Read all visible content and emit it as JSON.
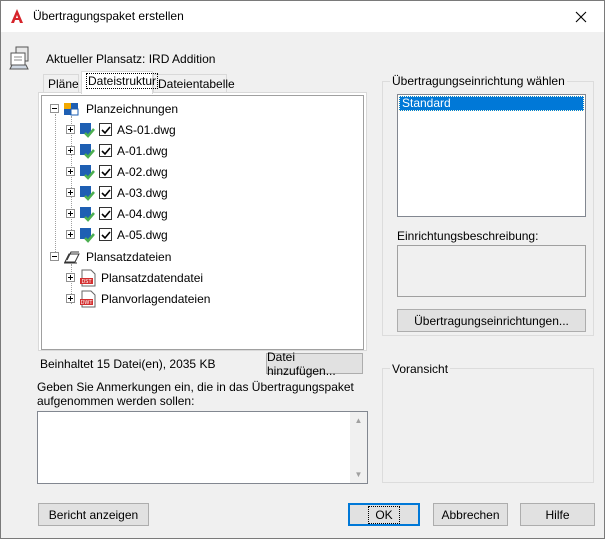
{
  "window": {
    "title": "Übertragungspaket erstellen"
  },
  "header": {
    "current_sheetset": "Aktueller Plansatz: IRD Addition"
  },
  "tabs": [
    {
      "label": "Pläne"
    },
    {
      "label": "Dateistruktur"
    },
    {
      "label": "Dateientabelle"
    }
  ],
  "tree": {
    "root1": {
      "label": "Planzeichnungen"
    },
    "files": [
      {
        "label": "AS-01.dwg",
        "checked": true
      },
      {
        "label": "A-01.dwg",
        "checked": true
      },
      {
        "label": "A-02.dwg",
        "checked": true
      },
      {
        "label": "A-03.dwg",
        "checked": true
      },
      {
        "label": "A-04.dwg",
        "checked": true
      },
      {
        "label": "A-05.dwg",
        "checked": true
      }
    ],
    "root2": {
      "label": "Plansatzdateien"
    },
    "sheetset_files": [
      {
        "label": "Plansatzdatendatei",
        "badge": "DST"
      },
      {
        "label": "Planvorlagendateien",
        "badge": "DWT"
      }
    ]
  },
  "status": {
    "contains": "Beinhaltet 15 Datei(en), 2035 KB"
  },
  "buttons": {
    "add_file": "Datei hinzufügen...",
    "transfer_setups": "Übertragungseinrichtungen...",
    "report": "Bericht anzeigen",
    "ok": "OK",
    "cancel": "Abbrechen",
    "help": "Hilfe"
  },
  "notes": {
    "label_line1": "Geben Sie Anmerkungen ein, die in das Übertragungspaket",
    "label_line2": "aufgenommen werden sollen:",
    "value": ""
  },
  "setup": {
    "group_label": "Übertragungseinrichtung wählen",
    "items": [
      "Standard"
    ],
    "selected": "Standard",
    "description_label": "Einrichtungsbeschreibung:",
    "description": ""
  },
  "preview": {
    "group_label": "Voransicht"
  },
  "colors": {
    "accent": "#0078d7",
    "check_green": "#4caf50",
    "file_blue": "#1e5fb3",
    "pdf_red": "#d32f2f"
  }
}
